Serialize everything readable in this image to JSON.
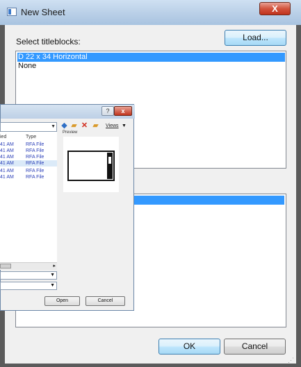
{
  "window": {
    "title": "New Sheet",
    "close_glyph": "X"
  },
  "main": {
    "select_label": "Select titleblocks:",
    "load_label": "Load...",
    "titleblocks": [
      "D 22 x 34 Horizontal",
      "None"
    ],
    "selected_index": 0
  },
  "footer": {
    "ok_label": "OK",
    "cancel_label": "Cancel"
  },
  "open_dialog": {
    "help_glyph": "?",
    "close_glyph": "x",
    "views_label": "Views",
    "preview_label": "Preview",
    "columns": {
      "modified": "ied",
      "type": "Type"
    },
    "rows": [
      {
        "modified": "41 AM",
        "type": "RFA File"
      },
      {
        "modified": "41 AM",
        "type": "RFA File"
      },
      {
        "modified": "41 AM",
        "type": "RFA File"
      },
      {
        "modified": "41 AM",
        "type": "RFA File"
      },
      {
        "modified": "41 AM",
        "type": "RFA File"
      },
      {
        "modified": "41 AM",
        "type": "RFA File"
      }
    ],
    "open_label": "Open",
    "cancel_label": "Cancel"
  },
  "colors": {
    "selection": "#3399ff",
    "accent": "#3c7fb1",
    "file_text": "#2b3fb8"
  }
}
